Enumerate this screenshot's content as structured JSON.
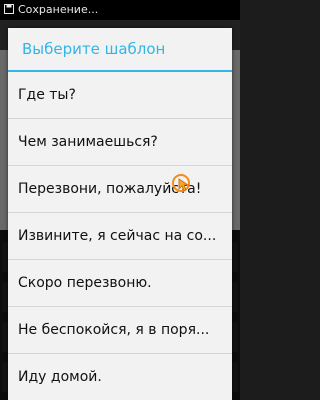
{
  "status_bar": {
    "notification_text": "Сохранение..."
  },
  "dialog": {
    "title": "Выберите шаблон",
    "title_color": "#33b5e5",
    "templates": [
      "Где ты?",
      "Чем занимаешься?",
      "Перезвони, пожалуйста!",
      "Извините, я сейчас на со...",
      "Скоро перезвоню.",
      "Не беспокойся, я в поря...",
      "Иду домой."
    ]
  },
  "icons": {
    "status": "save-icon",
    "touch": "touch-indicator-icon"
  }
}
